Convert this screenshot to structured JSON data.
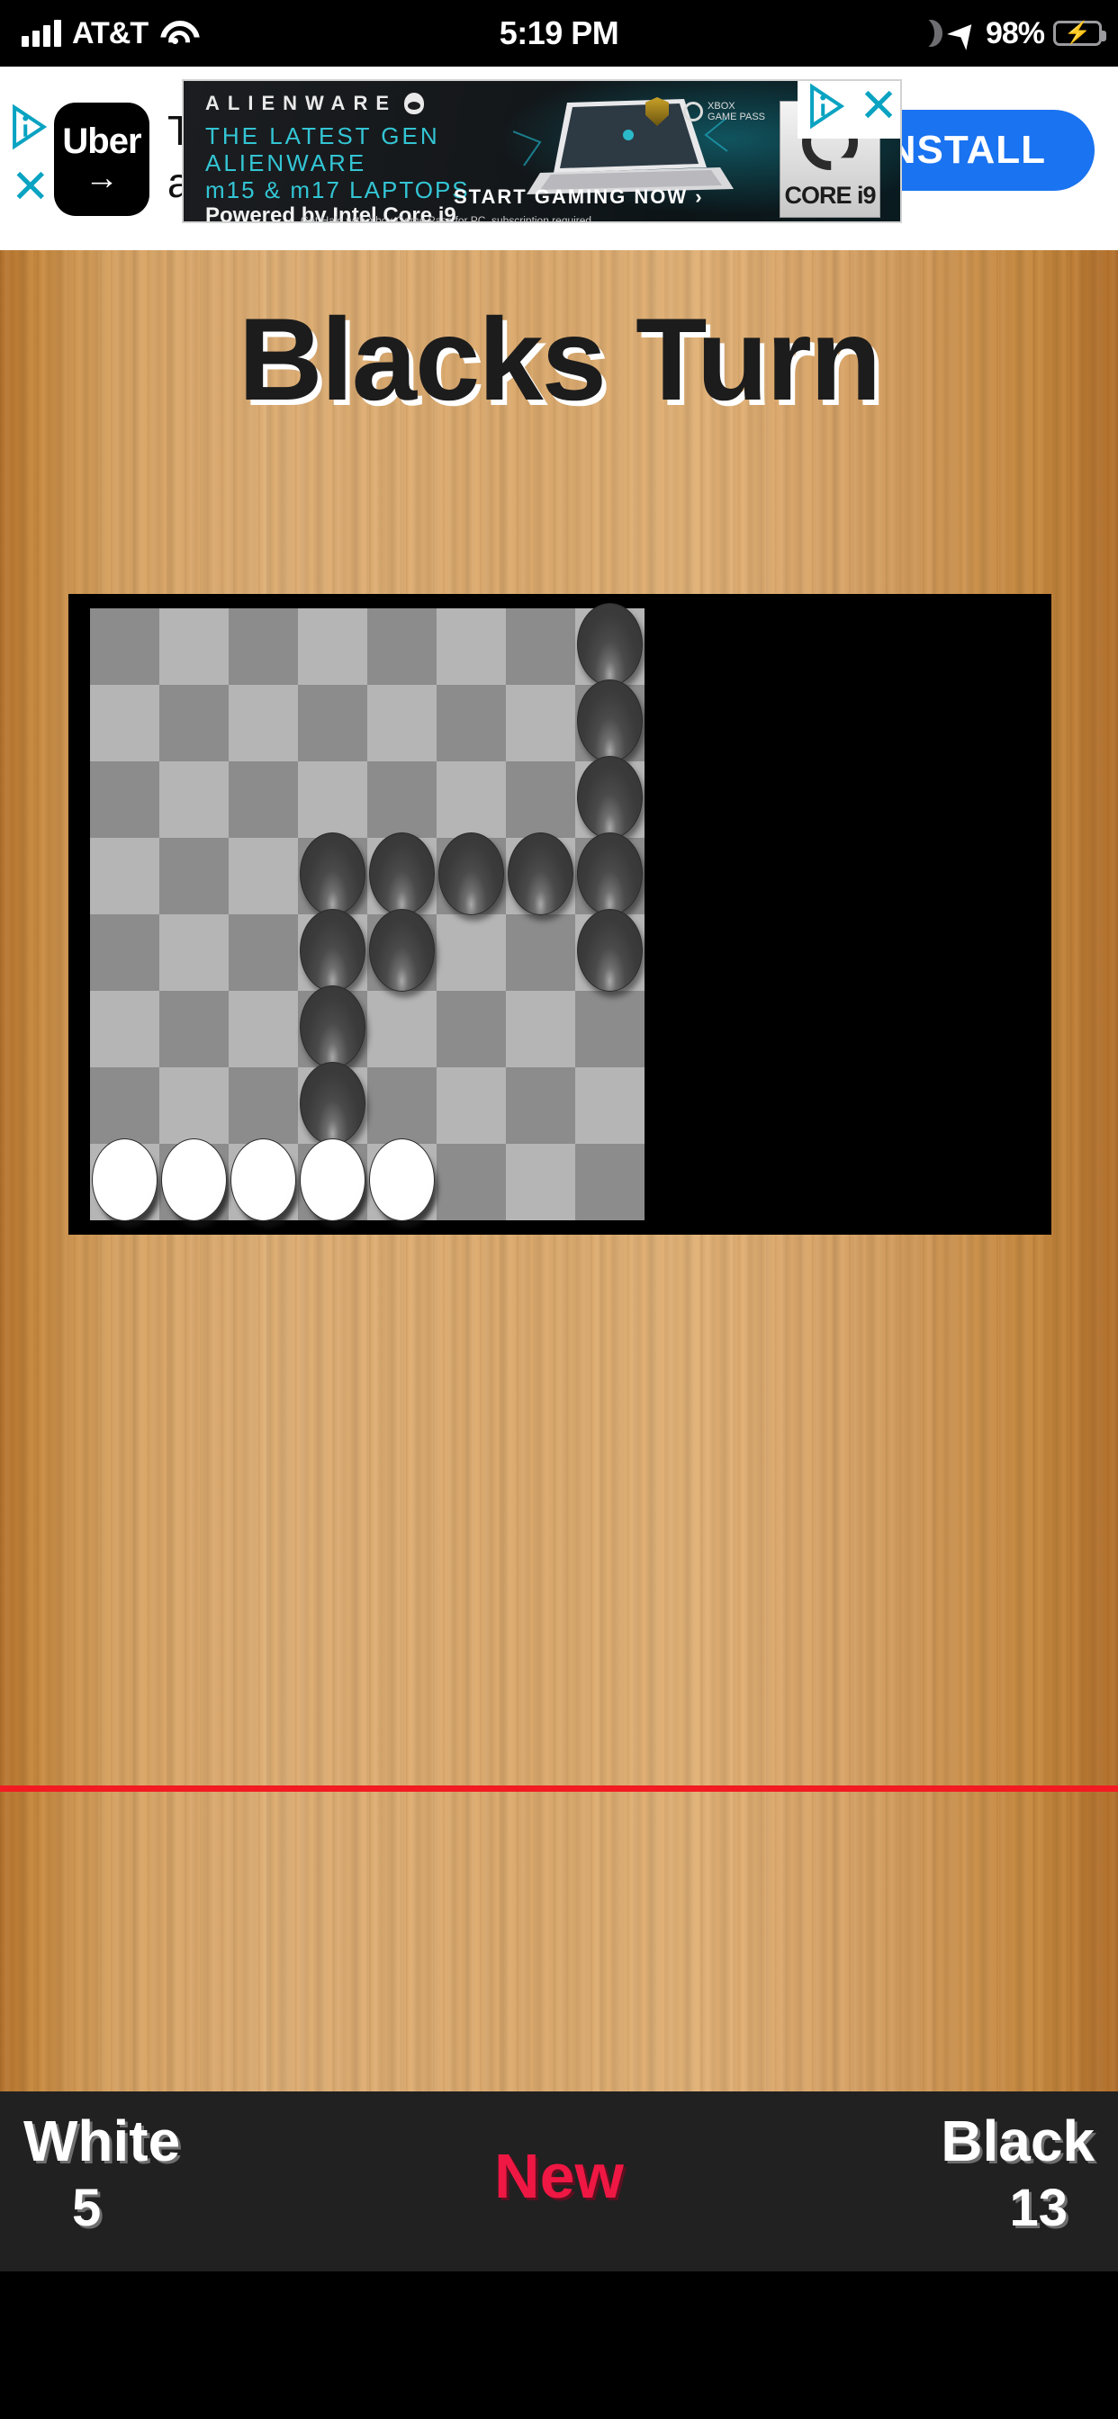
{
  "status_bar": {
    "carrier": "AT&T",
    "time": "5:19 PM",
    "battery_percent": "98%",
    "icons": [
      "signal-bars-icon",
      "wifi-icon",
      "moon-icon",
      "location-arrow-icon",
      "battery-charging-icon"
    ]
  },
  "ads": {
    "uber": {
      "logo_word": "Uber",
      "logo_arrow": "→",
      "headline": "T",
      "subline": "a",
      "install_label": "INSTALL",
      "close_label": "✕",
      "adchoices_label": "AdChoices"
    },
    "alienware": {
      "brand": "ALIENWARE",
      "line1": "THE LATEST GEN",
      "line2": "ALIENWARE",
      "line3": "m15 & m17 LAPTOPS",
      "line4": "Powered by Intel Core i9",
      "cta": "START GAMING NOW ›",
      "fineprint": "Get Halo with Xbox Game Pass for PC, subscription required",
      "badge_text": "CORE i9",
      "close_label": "✕",
      "adchoices_label": "AdChoices"
    }
  },
  "game": {
    "turn_title": "Blacks Turn",
    "board": {
      "rows": 8,
      "cols": 8,
      "light_color": "#b5b5b5",
      "dark_color": "#8c8c8c",
      "frame_color": "#000000",
      "pieces": [
        {
          "row": 1,
          "col": 8,
          "color": "black"
        },
        {
          "row": 2,
          "col": 8,
          "color": "black"
        },
        {
          "row": 3,
          "col": 8,
          "color": "black"
        },
        {
          "row": 4,
          "col": 4,
          "color": "black"
        },
        {
          "row": 4,
          "col": 5,
          "color": "black"
        },
        {
          "row": 4,
          "col": 6,
          "color": "black"
        },
        {
          "row": 4,
          "col": 7,
          "color": "black"
        },
        {
          "row": 4,
          "col": 8,
          "color": "black"
        },
        {
          "row": 5,
          "col": 4,
          "color": "black"
        },
        {
          "row": 5,
          "col": 5,
          "color": "black"
        },
        {
          "row": 5,
          "col": 8,
          "color": "black"
        },
        {
          "row": 6,
          "col": 4,
          "color": "black"
        },
        {
          "row": 7,
          "col": 4,
          "color": "black"
        },
        {
          "row": 8,
          "col": 1,
          "color": "white"
        },
        {
          "row": 8,
          "col": 2,
          "color": "white"
        },
        {
          "row": 8,
          "col": 3,
          "color": "white"
        },
        {
          "row": 8,
          "col": 4,
          "color": "white"
        },
        {
          "row": 8,
          "col": 5,
          "color": "white"
        }
      ]
    }
  },
  "scorebar": {
    "white_label": "White",
    "white_score": "5",
    "new_label": "New",
    "black_label": "Black",
    "black_score": "13",
    "new_color": "#ef1743",
    "background": "#212121"
  }
}
